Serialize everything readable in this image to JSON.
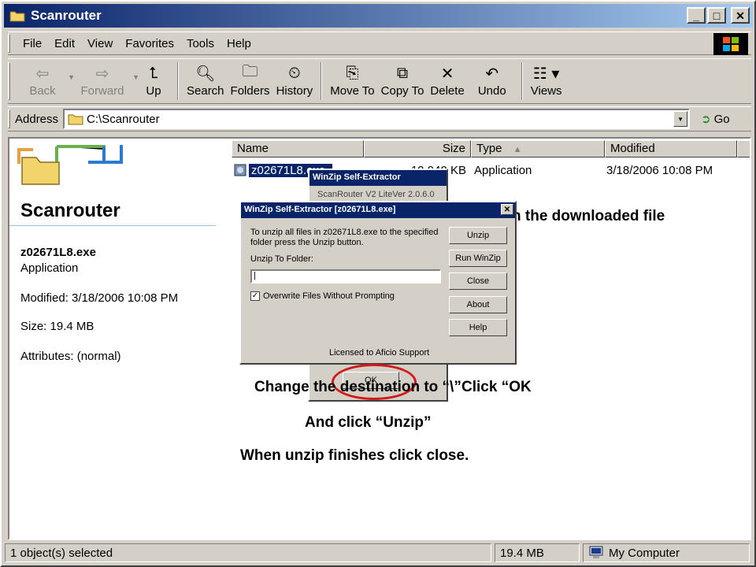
{
  "window": {
    "title": "Scanrouter",
    "controls": {
      "minimize": "_",
      "maximize": "□",
      "close": "✕"
    }
  },
  "menu": [
    "File",
    "Edit",
    "View",
    "Favorites",
    "Tools",
    "Help"
  ],
  "toolbar": {
    "back": "Back",
    "forward": "Forward",
    "up": "Up",
    "search": "Search",
    "folders": "Folders",
    "history": "History",
    "move_to": "Move To",
    "copy_to": "Copy To",
    "delete": "Delete",
    "undo": "Undo",
    "views": "Views"
  },
  "address": {
    "label": "Address",
    "value": "C:\\Scanrouter",
    "go": "Go"
  },
  "left_pane": {
    "folder_title": "Scanrouter",
    "file_name": "z02671L8.exe",
    "file_type": "Application",
    "modified": "Modified: 3/18/2006 10:08 PM",
    "size": "Size: 19.4 MB",
    "attributes": "Attributes: (normal)"
  },
  "columns": {
    "name": "Name",
    "size": "Size",
    "type": "Type",
    "modified": "Modified"
  },
  "files": [
    {
      "name": "z02671L8.exe",
      "size": "19,940 KB",
      "type": "Application",
      "modified": "3/18/2006 10:08 PM"
    }
  ],
  "status": {
    "selected": "1 object(s) selected",
    "size": "19.4 MB",
    "location": "My Computer"
  },
  "back_dialog": {
    "title": "WinZip Self-Extractor",
    "subtitle": "ScanRouter V2 LiteVer 2.0.6.0",
    "ok": "OK"
  },
  "dialog": {
    "title": "WinZip Self-Extractor [z02671L8.exe]",
    "close": "✕",
    "instructions": "To unzip all files in z02671L8.exe to the specified folder press the Unzip button.",
    "folder_label": "Unzip To Folder:",
    "folder_value": "",
    "overwrite_label": "Overwrite Files Without Prompting",
    "overwrite_checked": "✓",
    "license": "Licensed to Aficio Support",
    "buttons": {
      "unzip": "Unzip",
      "run_winzip": "Run WinZip",
      "close": "Close",
      "about": "About",
      "help": "Help"
    }
  },
  "annotations": {
    "downloaded": "n the downloaded file",
    "change_dest": "Change the destination to “\\”",
    "click_ok": "Click “OK",
    "click_unzip": "And click “Unzip”",
    "close_when_done": "When unzip finishes click close.",
    "circle_color": "#d21a1a"
  }
}
